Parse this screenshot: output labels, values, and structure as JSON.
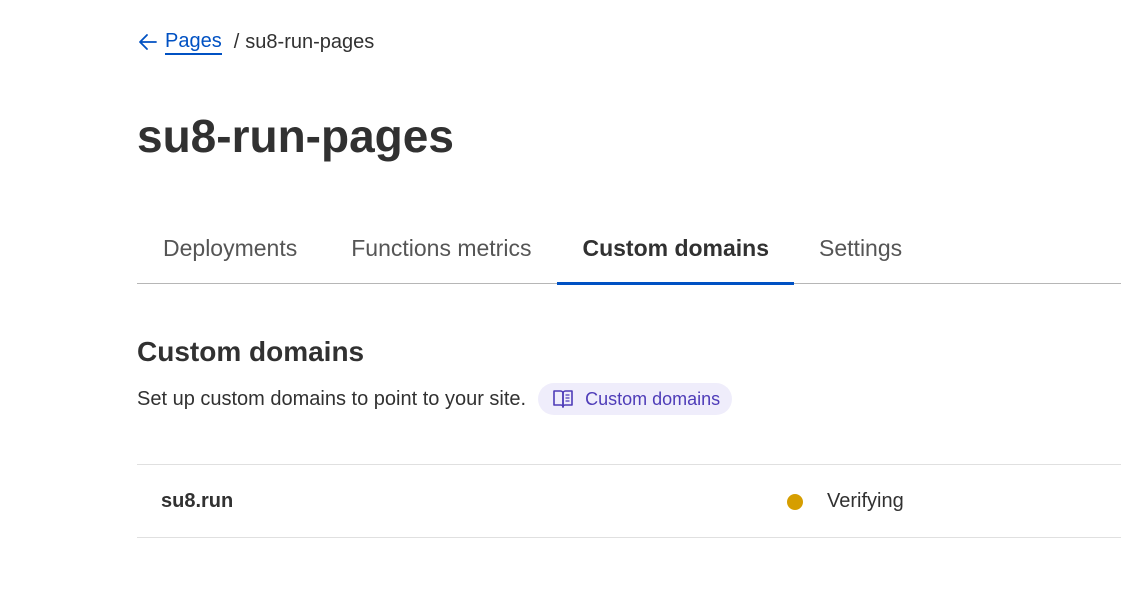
{
  "breadcrumb": {
    "back_label": "Pages",
    "separator": "/",
    "current": "su8-run-pages"
  },
  "page": {
    "title": "su8-run-pages"
  },
  "tabs": [
    {
      "label": "Deployments",
      "active": false
    },
    {
      "label": "Functions metrics",
      "active": false
    },
    {
      "label": "Custom domains",
      "active": true
    },
    {
      "label": "Settings",
      "active": false
    }
  ],
  "section": {
    "title": "Custom domains",
    "description": "Set up custom domains to point to your site.",
    "docs_link_label": "Custom domains",
    "docs_icon": "book-open-icon"
  },
  "domains": [
    {
      "name": "su8.run",
      "status": "Verifying",
      "status_color": "#d69e00"
    }
  ],
  "colors": {
    "accent": "#0051c3",
    "docs_pill_bg": "#efedfb",
    "docs_pill_text": "#4e3cb8"
  }
}
